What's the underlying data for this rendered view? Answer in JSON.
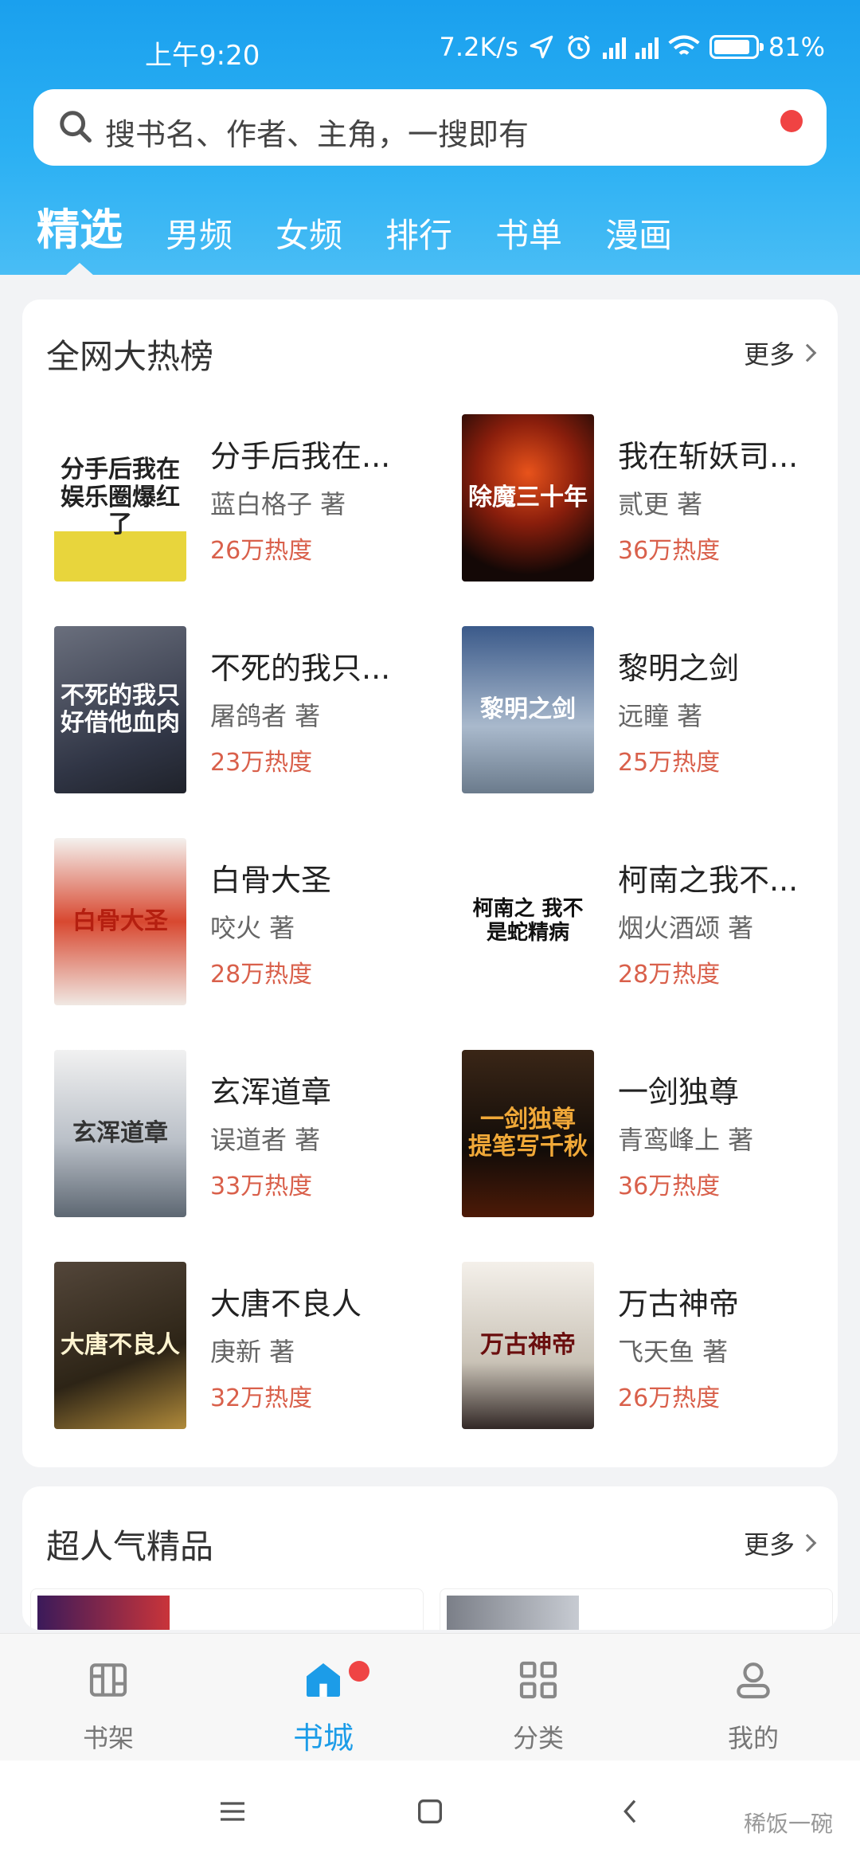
{
  "status_bar": {
    "time": "上午9:20",
    "speed": "7.2K/s",
    "battery": "81%"
  },
  "search": {
    "placeholder": "搜书名、作者、主角，一搜即有"
  },
  "tabs": [
    "精选",
    "男频",
    "女频",
    "排行",
    "书单",
    "漫画"
  ],
  "hot_list": {
    "title": "全网大热榜",
    "more": "更多",
    "books": [
      {
        "title": "分手后我在...",
        "author": "蓝白格子 著",
        "heat": "26万热度",
        "cover_text": "分手后我在娱乐圈爆红了"
      },
      {
        "title": "我在斩妖司...",
        "author": "贰更 著",
        "heat": "36万热度",
        "cover_text": "除魔三十年"
      },
      {
        "title": "不死的我只...",
        "author": "屠鸽者 著",
        "heat": "23万热度",
        "cover_text": "不死的我只好借他血肉"
      },
      {
        "title": "黎明之剑",
        "author": "远瞳 著",
        "heat": "25万热度",
        "cover_text": "黎明之剑"
      },
      {
        "title": "白骨大圣",
        "author": "咬火 著",
        "heat": "28万热度",
        "cover_text": "白骨大圣"
      },
      {
        "title": "柯南之我不...",
        "author": "烟火酒颂 著",
        "heat": "28万热度",
        "cover_text": "柯南之 我不是蛇精病"
      },
      {
        "title": "玄浑道章",
        "author": "误道者 著",
        "heat": "33万热度",
        "cover_text": "玄浑道章"
      },
      {
        "title": "一剑独尊",
        "author": "青鸾峰上 著",
        "heat": "36万热度",
        "cover_text": "一剑独尊 提笔写千秋"
      },
      {
        "title": "大唐不良人",
        "author": "庚新 著",
        "heat": "32万热度",
        "cover_text": "大唐不良人"
      },
      {
        "title": "万古神帝",
        "author": "飞天鱼 著",
        "heat": "26万热度",
        "cover_text": "万古神帝"
      }
    ]
  },
  "premium": {
    "title": "超人气精品",
    "more": "更多"
  },
  "bottom_nav": [
    "书架",
    "书城",
    "分类",
    "我的"
  ],
  "watermark": "稀饭一碗",
  "colors": {
    "brand_blue": "#1aa0ee",
    "heat_red": "#d9604b",
    "badge_red": "#ef4444"
  }
}
